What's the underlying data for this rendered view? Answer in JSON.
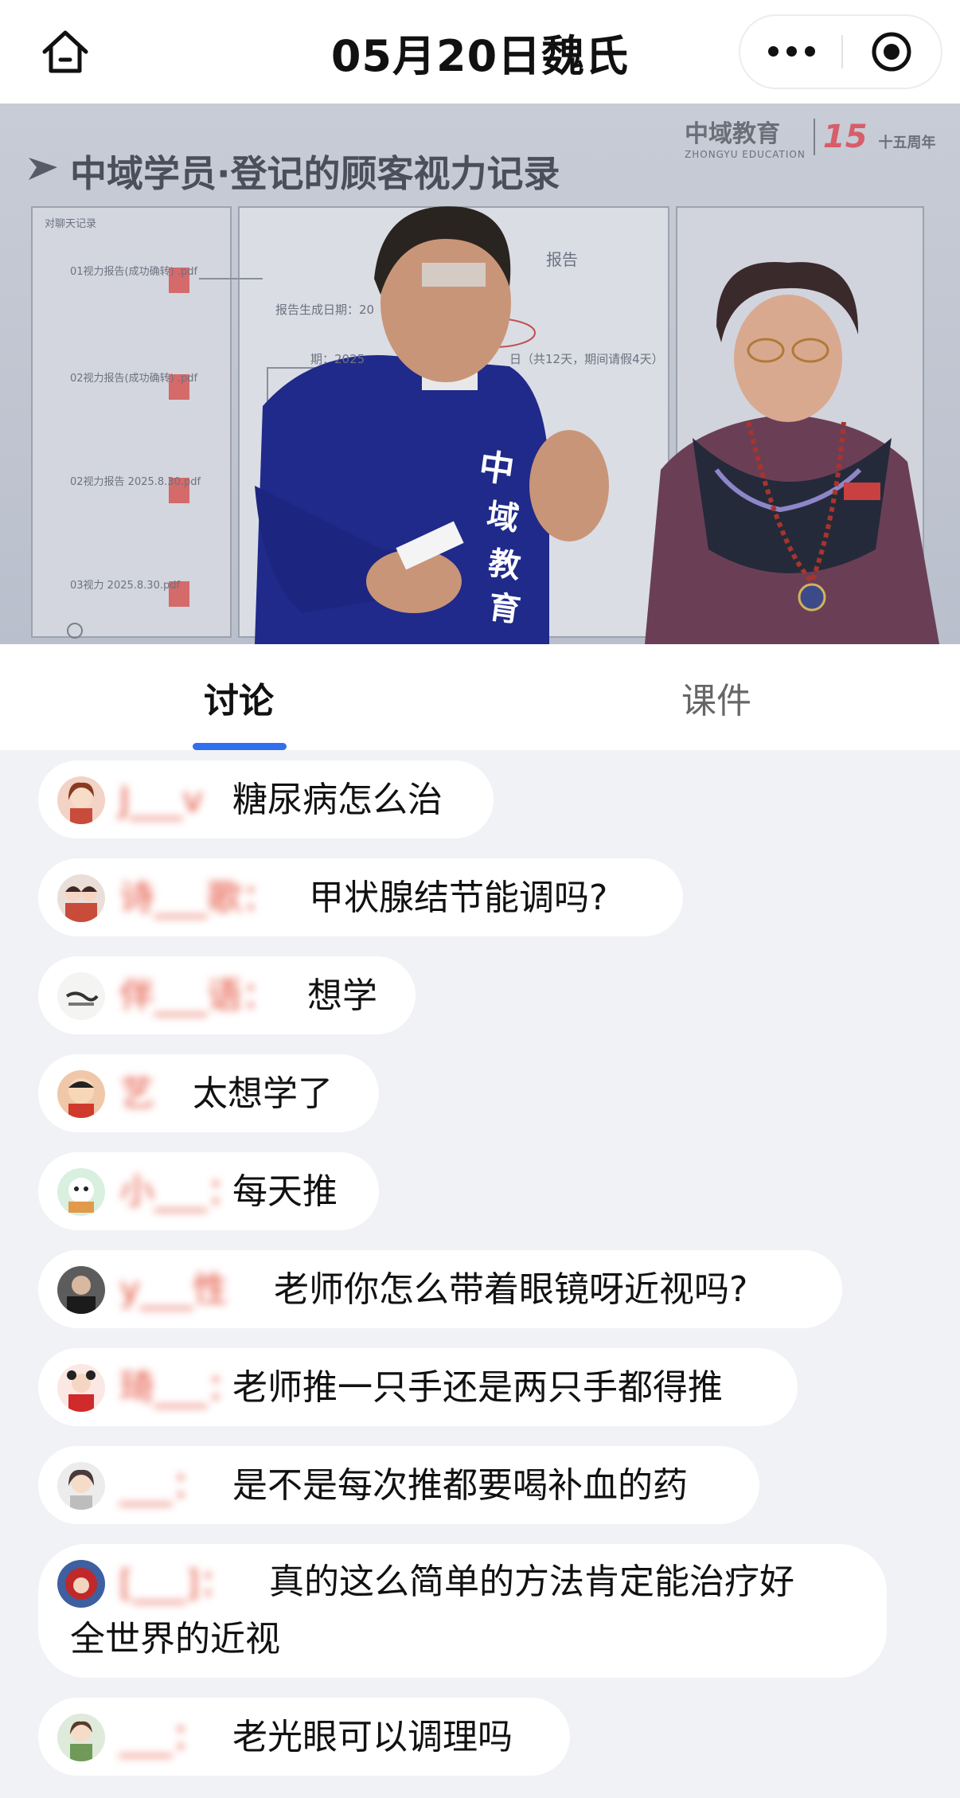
{
  "navbar": {
    "title": "05月20日魏氏",
    "home_icon": "home-icon",
    "more_icon": "more-dots-icon",
    "target_icon": "record-target-icon"
  },
  "video": {
    "slide_title": "中域学员·登记的顾客视力记录",
    "brand_name": "中域教育",
    "brand_sub": "ZHONGYU EDUCATION",
    "anniversary_num": "15",
    "anniversary_text": "十五周年",
    "panel_header": "对聊天记录",
    "report_word": "报告",
    "report_date_label": "报告生成日期：20",
    "report_period_label": "期：2025",
    "report_period_note": "日（共12天，期间请假4天）",
    "files": [
      "01视力报告(成功确转) .pdf",
      "02视力报告(成功确转) .pdf",
      "02视力报告 2025.8.30.pdf",
      "03视力 2025.8.30.pdf"
    ],
    "shirt_text": "中域教育"
  },
  "tabs": {
    "discuss": "讨论",
    "courseware": "课件"
  },
  "comments": [
    {
      "name": "J___v",
      "text": "糖尿病怎么治",
      "avatar": "avatar-girl-icon"
    },
    {
      "name": "诗___歌：",
      "text": "甲状腺结节能调吗?",
      "avatar": "avatar-couple-icon"
    },
    {
      "name": "伴___语：",
      "text": "想学",
      "avatar": "avatar-calligraphy-icon"
    },
    {
      "name": "艺",
      "text": "太想学了",
      "avatar": "avatar-cartoon-icon"
    },
    {
      "name": "小___：",
      "text": "每天推",
      "avatar": "avatar-panda-icon"
    },
    {
      "name": "y___性",
      "text": "老师你怎么带着眼镜呀近视吗?",
      "avatar": "avatar-man-icon"
    },
    {
      "name": "琦___：",
      "text": "老师推一只手还是两只手都得推",
      "avatar": "avatar-kid-icon"
    },
    {
      "name": "___：",
      "text": "是不是每次推都要喝补血的药",
      "avatar": "avatar-woman-icon"
    },
    {
      "name": "[___]：",
      "text": "真的这么简单的方法肯定能治疗好",
      "text2": "全世界的近视",
      "avatar": "avatar-red-hood-icon"
    },
    {
      "name": "___：",
      "text": "老光眼可以调理吗",
      "avatar": "avatar-anime-girl-icon"
    }
  ]
}
